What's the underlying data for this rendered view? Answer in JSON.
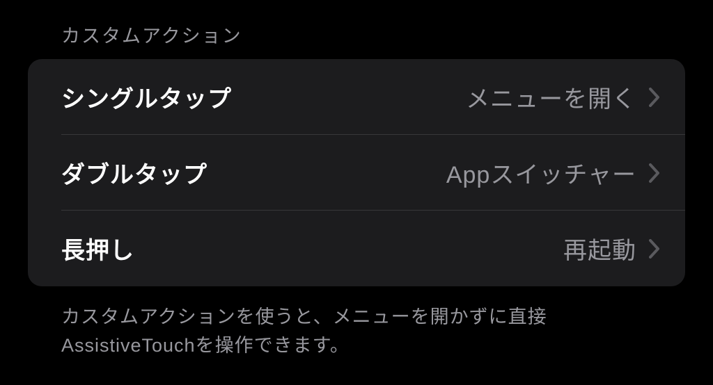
{
  "section": {
    "header": "カスタムアクション",
    "footer": "カスタムアクションを使うと、メニューを開かずに直接AssistiveTouchを操作できます。",
    "rows": [
      {
        "label": "シングルタップ",
        "value": "メニューを開く"
      },
      {
        "label": "ダブルタップ",
        "value": "Appスイッチャー"
      },
      {
        "label": "長押し",
        "value": "再起動"
      }
    ]
  }
}
